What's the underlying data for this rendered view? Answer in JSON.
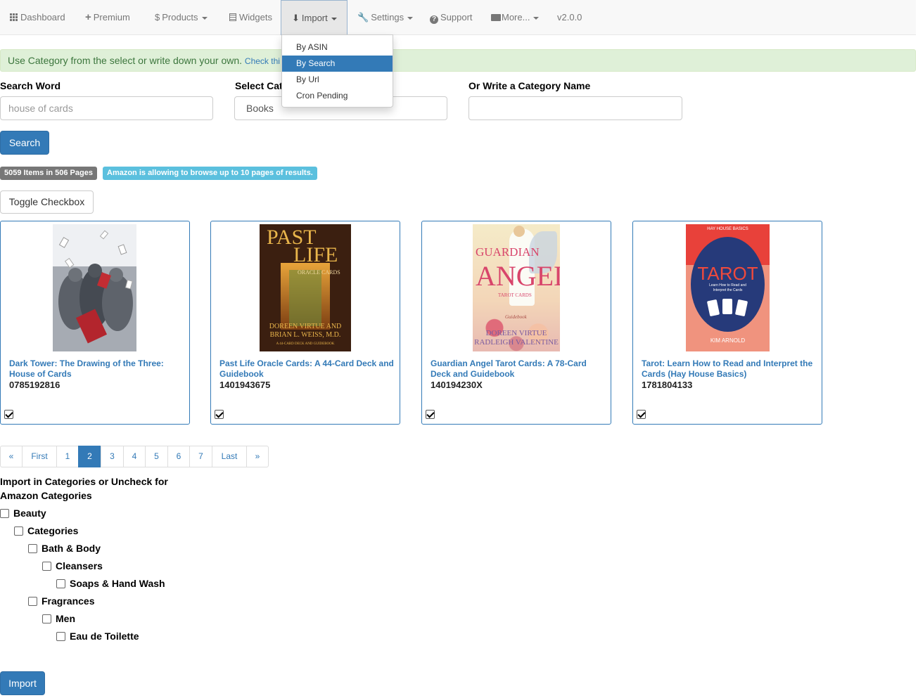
{
  "nav": {
    "items": [
      {
        "label": "Dashboard",
        "icon": "grid-icon"
      },
      {
        "label": "Premium",
        "icon": "plus-icon"
      },
      {
        "label": "Products",
        "icon": "dollar-icon"
      },
      {
        "label": "Widgets",
        "icon": "list-icon"
      },
      {
        "label": "Import",
        "icon": "import-icon"
      },
      {
        "label": "Settings",
        "icon": "wrench-icon"
      },
      {
        "label": "Support",
        "icon": "question-icon"
      },
      {
        "label": "More...",
        "icon": "folder-icon"
      }
    ],
    "version": "v2.0.0"
  },
  "import_menu": {
    "items": [
      "By ASIN",
      "By Search",
      "By Url",
      "Cron Pending"
    ],
    "active": "By Search"
  },
  "alert": {
    "text": "Use Category from the select or write down your own.",
    "link": "Check thi"
  },
  "form": {
    "search_word_label": "Search Word",
    "search_word_placeholder": "house of cards",
    "select_category_label": "Select Cat",
    "select_category_value": "Books",
    "write_category_label": "Or Write a Category Name",
    "write_category_value": "",
    "search_button": "Search"
  },
  "results": {
    "count_badge": "5059 Items in 506 Pages",
    "info_badge": "Amazon is allowing to browse up to 10 pages of results.",
    "toggle_button": "Toggle Checkbox"
  },
  "products": [
    {
      "title": "Dark Tower: The Drawing of the Three: House of Cards",
      "asin": "0785192816",
      "checked": true
    },
    {
      "title": "Past Life Oracle Cards: A 44-Card Deck and Guidebook",
      "asin": "1401943675",
      "checked": true,
      "cover": {
        "t1": "PAST",
        "t2": "LIFE",
        "t3": "ORACLE CARDS",
        "a1": "DOREEN VIRTUE AND",
        "a2": "BRIAN L. WEISS, M.D.",
        "a3": "A 44-CARD DECK AND GUIDEBOOK"
      }
    },
    {
      "title": "Guardian Angel Tarot Cards: A 78-Card Deck and Guidebook",
      "asin": "140194230X",
      "checked": true,
      "cover": {
        "t1": "GUARDIAN",
        "t2": "ANGEL",
        "t3": "TAROT CARDS",
        "t4": "Guidebook",
        "a1": "DOREEN VIRTUE",
        "a2": "RADLEIGH VALENTINE"
      }
    },
    {
      "title": "Tarot: Learn How to Read and Interpret the Cards (Hay House Basics)",
      "asin": "1781804133",
      "checked": true,
      "cover": {
        "top": "HAY HOUSE BASICS",
        "t1": "TAROT",
        "t2": "Learn How to Read and Interpret the Cards",
        "author": "KIM ARNOLD"
      }
    }
  ],
  "pagination": {
    "items": [
      "«",
      "First",
      "1",
      "2",
      "3",
      "4",
      "5",
      "6",
      "7",
      "Last",
      "»"
    ],
    "active": "2"
  },
  "categories": {
    "heading": "Import in Categories or Uncheck for Amazon Categories",
    "tree": [
      {
        "label": "Beauty",
        "level": 0
      },
      {
        "label": "Categories",
        "level": 1
      },
      {
        "label": "Bath & Body",
        "level": 2
      },
      {
        "label": "Cleansers",
        "level": 3
      },
      {
        "label": "Soaps & Hand Wash",
        "level": 4
      },
      {
        "label": "Fragrances",
        "level": 2
      },
      {
        "label": "Men",
        "level": 3
      },
      {
        "label": "Eau de Toilette",
        "level": 4
      }
    ],
    "import_button": "Import"
  }
}
